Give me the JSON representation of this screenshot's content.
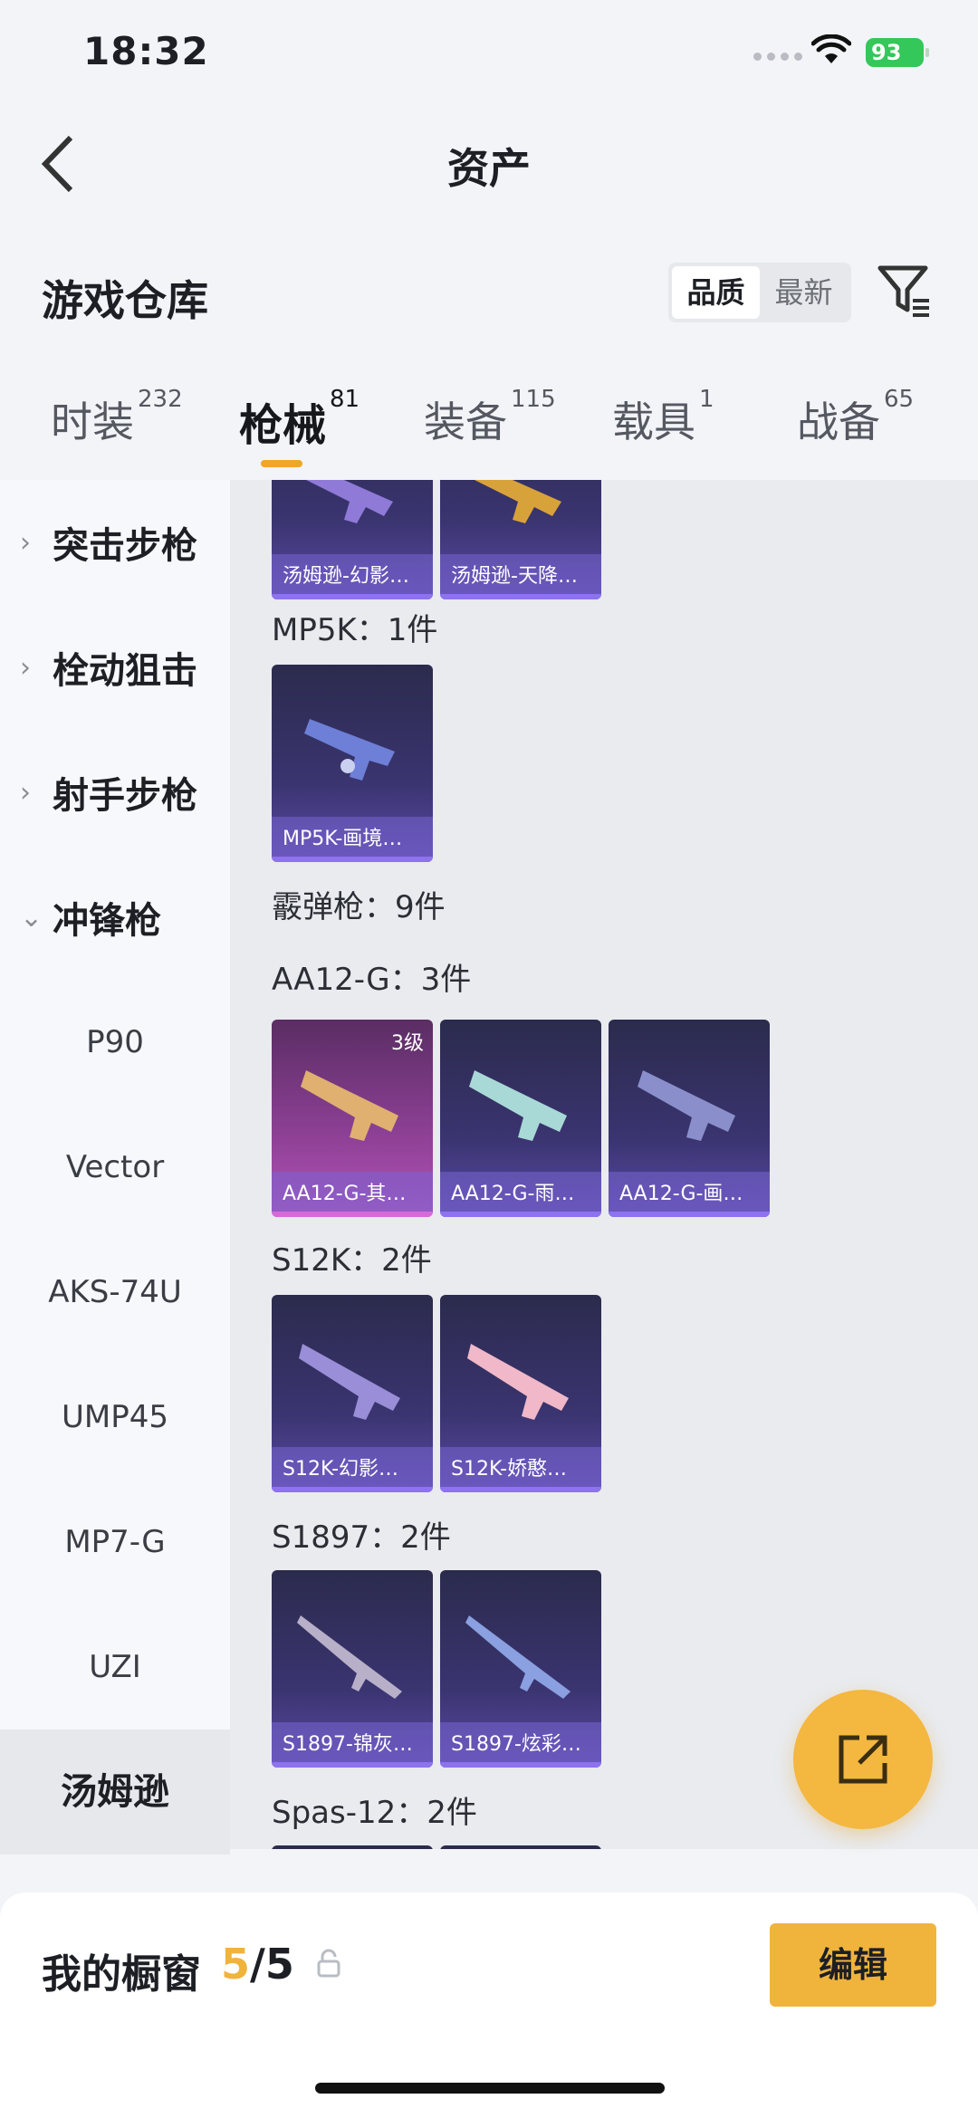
{
  "status": {
    "time": "18:32",
    "battery": "93"
  },
  "nav": {
    "title": "资产"
  },
  "warehouse": {
    "title": "游戏仓库",
    "sort": [
      "品质",
      "最新"
    ]
  },
  "tabs": [
    {
      "label": "时装",
      "count": "232"
    },
    {
      "label": "枪械",
      "count": "81"
    },
    {
      "label": "装备",
      "count": "115"
    },
    {
      "label": "载具",
      "count": "1"
    },
    {
      "label": "战备",
      "count": "65"
    }
  ],
  "sidebar": {
    "categories": [
      "突击步枪",
      "栓动狙击",
      "射手步枪",
      "冲锋枪"
    ],
    "subs": [
      "P90",
      "Vector",
      "AKS-74U",
      "UMP45",
      "MP7-G",
      "UZI",
      "汤姆逊"
    ]
  },
  "content": {
    "top_cards": [
      "汤姆逊-幻影…",
      "汤姆逊-天降…"
    ],
    "mp5k": {
      "label": "MP5K：1件",
      "cards": [
        "MP5K-画境…"
      ]
    },
    "shotgun": {
      "label": "霰弹枪：9件"
    },
    "aa12": {
      "label": "AA12-G：3件",
      "badge": "3级",
      "cards": [
        "AA12-G-其…",
        "AA12-G-雨…",
        "AA12-G-画…"
      ]
    },
    "s12k": {
      "label": "S12K：2件",
      "cards": [
        "S12K-幻影…",
        "S12K-娇憨…"
      ]
    },
    "s1897": {
      "label": "S1897：2件",
      "cards": [
        "S1897-锦灰…",
        "S1897-炫彩…"
      ]
    },
    "spas": {
      "label": "Spas-12：2件"
    }
  },
  "bottom": {
    "showcase_label": "我的橱窗",
    "current": "5",
    "total": "/5",
    "edit": "编辑"
  },
  "colors": {
    "accent": "#f0b43c",
    "card_purple": "#3a3470",
    "card_gold": "#b453b8"
  }
}
